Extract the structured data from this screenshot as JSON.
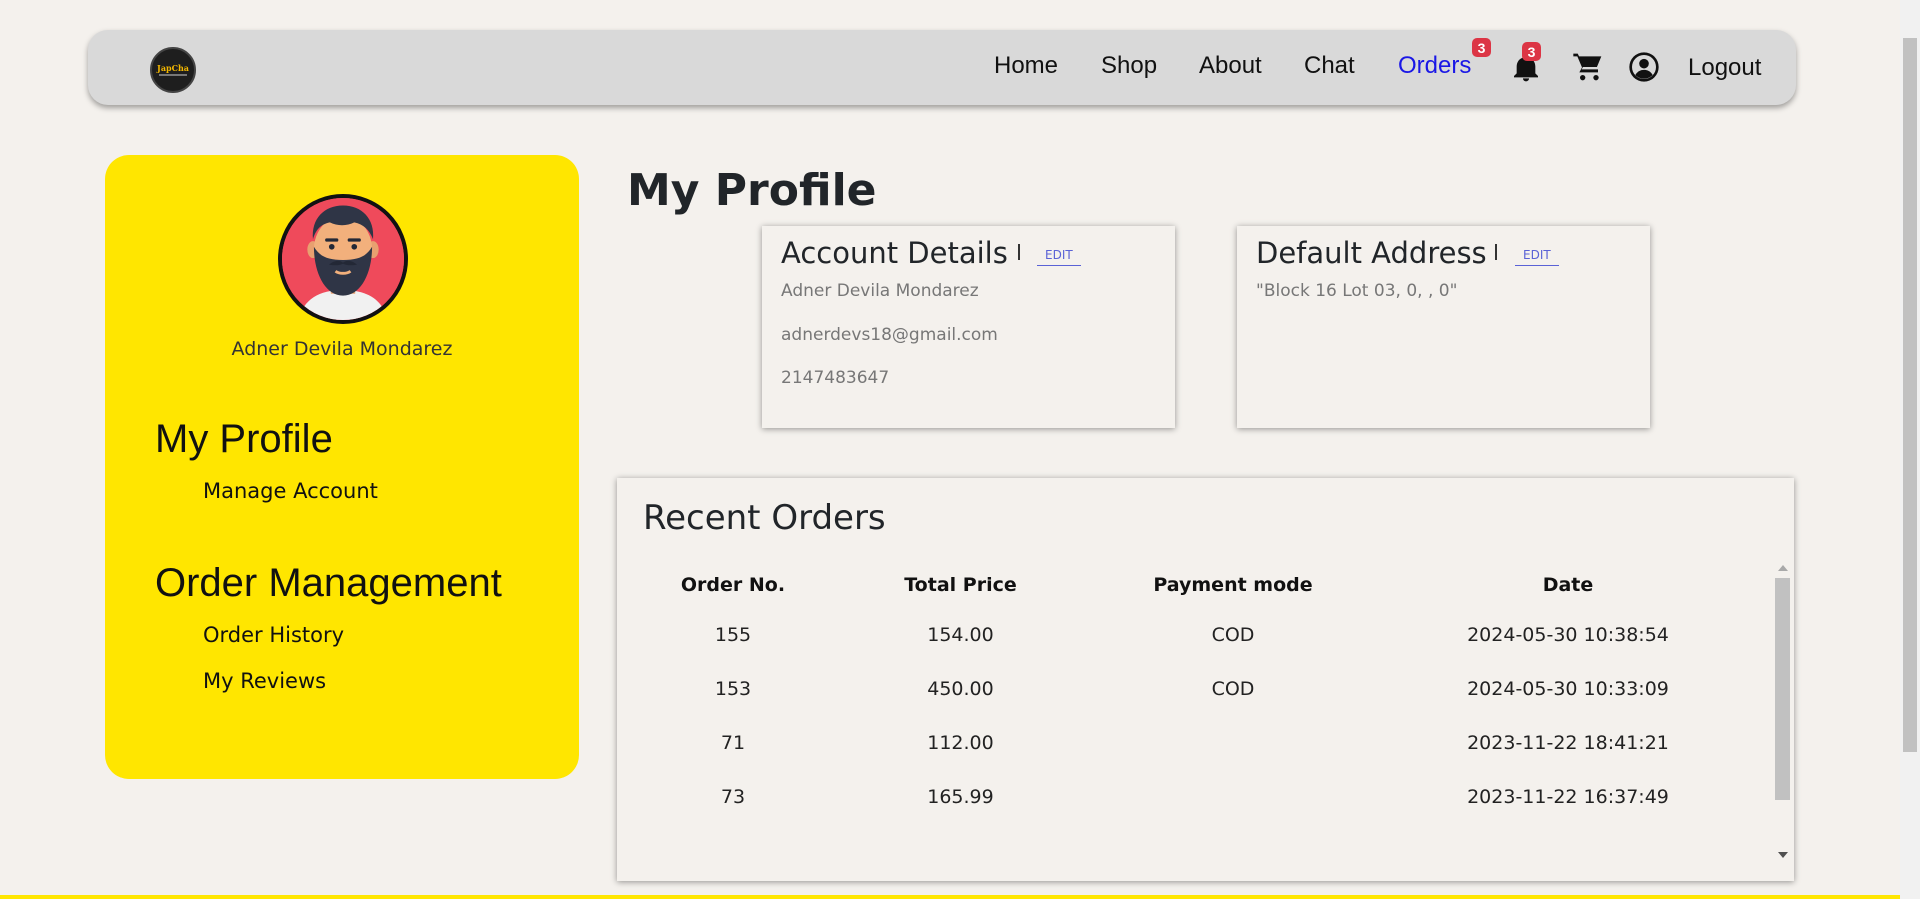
{
  "navbar": {
    "logo_text": "JapCha",
    "items": [
      {
        "label": "Home"
      },
      {
        "label": "Shop"
      },
      {
        "label": "About"
      },
      {
        "label": "Chat"
      },
      {
        "label": "Orders"
      }
    ],
    "orders_badge": "3",
    "notification_badge": "3",
    "logout_label": "Logout",
    "active_color": "#1a17e6"
  },
  "sidebar": {
    "username": "Adner Devila Mondarez",
    "sections": [
      {
        "heading": "My Profile",
        "links": [
          "Manage Account"
        ]
      },
      {
        "heading": "Order Management",
        "links": [
          "Order History",
          "My Reviews"
        ]
      }
    ],
    "background": "#ffe600"
  },
  "main": {
    "title": "My Profile",
    "account": {
      "title": "Account Details",
      "edit_label": "EDIT",
      "name": "Adner Devila Mondarez",
      "email": "adnerdevs18@gmail.com",
      "phone": "2147483647"
    },
    "address": {
      "title": "Default Address",
      "edit_label": "EDIT",
      "value": "\"Block 16 Lot 03, 0, , 0\""
    },
    "orders": {
      "title": "Recent Orders",
      "columns": [
        "Order No.",
        "Total Price",
        "Payment mode",
        "Date"
      ],
      "rows": [
        {
          "order_no": "155",
          "total": "154.00",
          "payment": "COD",
          "date": "2024-05-30 10:38:54"
        },
        {
          "order_no": "153",
          "total": "450.00",
          "payment": "COD",
          "date": "2024-05-30 10:33:09"
        },
        {
          "order_no": "71",
          "total": "112.00",
          "payment": "",
          "date": "2023-11-22 18:41:21"
        },
        {
          "order_no": "73",
          "total": "165.99",
          "payment": "",
          "date": "2023-11-22 16:37:49"
        }
      ]
    }
  }
}
